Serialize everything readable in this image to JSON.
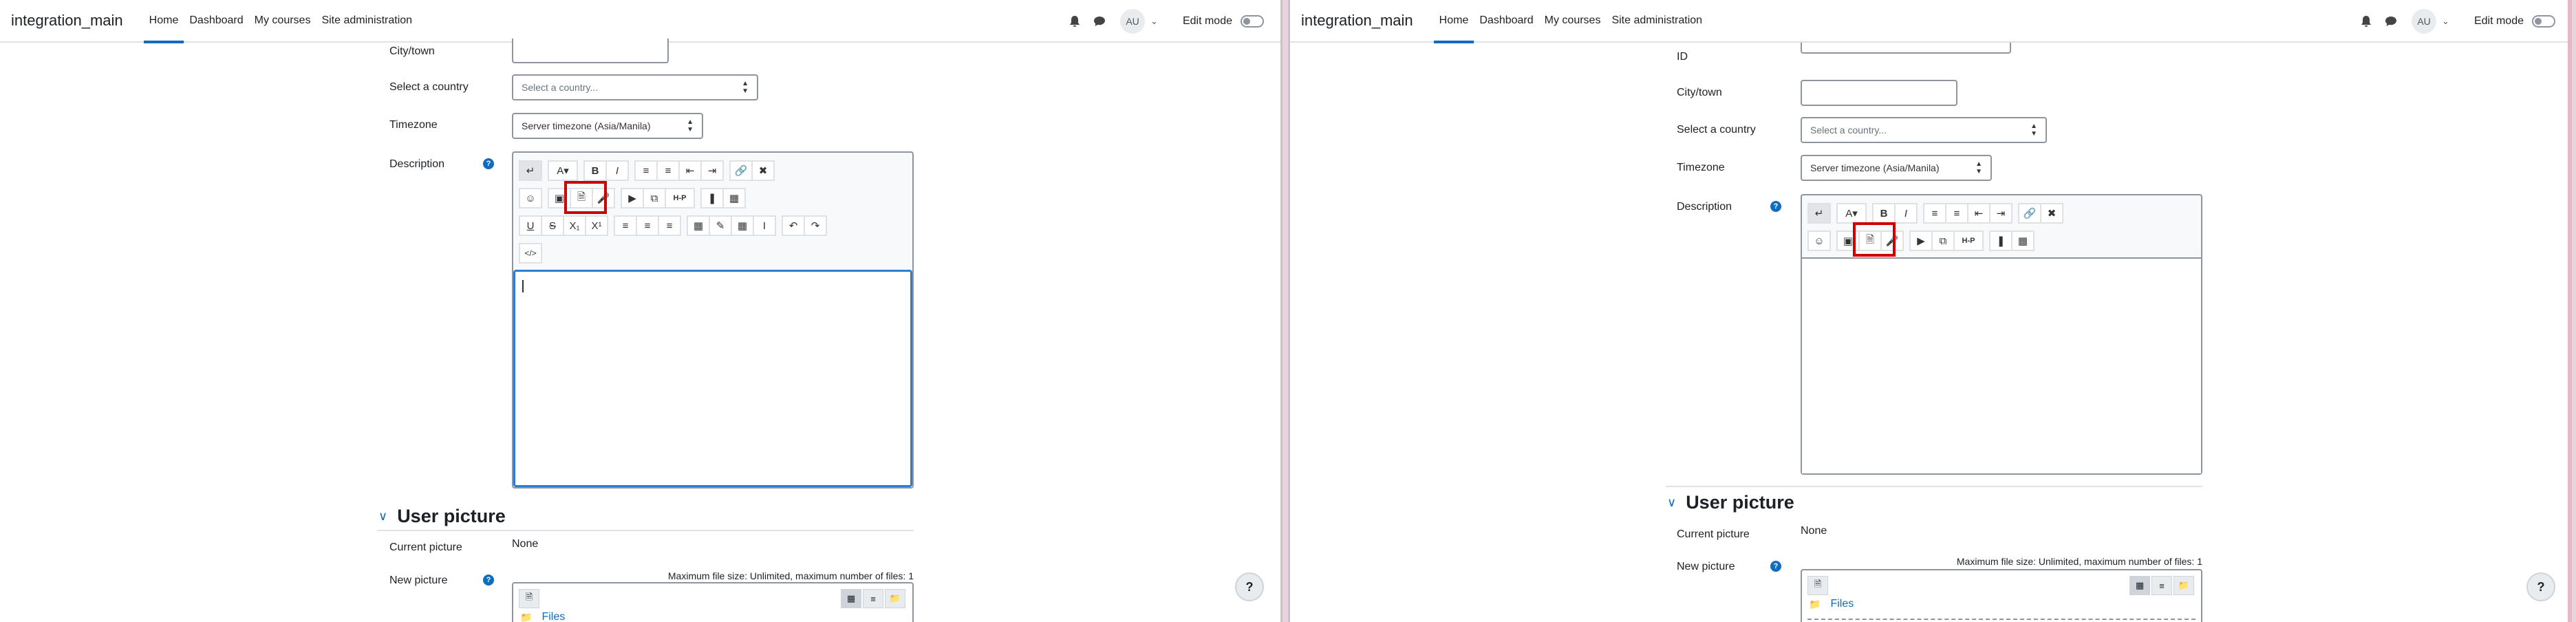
{
  "nav": {
    "brand": "integration_main",
    "links": [
      "Home",
      "Dashboard",
      "My courses",
      "Site administration"
    ],
    "avatar": "AU",
    "edit_mode": "Edit mode"
  },
  "form": {
    "top_cut_label": "ID",
    "city_label": "City/town",
    "country_label": "Select a country",
    "country_placeholder": "Select a country...",
    "timezone_label": "Timezone",
    "timezone_value": "Server timezone (Asia/Manila)",
    "description_label": "Description"
  },
  "user_picture": {
    "heading": "User picture",
    "current_label": "Current picture",
    "current_value": "None",
    "new_label": "New picture",
    "max_size": "Maximum file size: Unlimited, maximum number of files: 1",
    "files_label": "Files"
  },
  "help_fab": "?",
  "help_glyph": "?"
}
